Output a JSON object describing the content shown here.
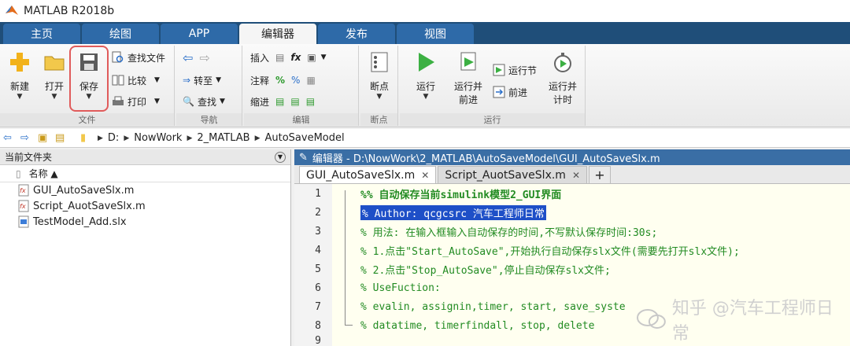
{
  "window": {
    "title": "MATLAB R2018b"
  },
  "tabs": [
    {
      "label": "主页"
    },
    {
      "label": "绘图"
    },
    {
      "label": "APP"
    },
    {
      "label": "编辑器"
    },
    {
      "label": "发布"
    },
    {
      "label": "视图"
    }
  ],
  "ribbon": {
    "file": {
      "label": "文件",
      "new": "新建",
      "open": "打开",
      "save": "保存",
      "find_files": "查找文件",
      "compare": "比较",
      "print": "打印"
    },
    "nav": {
      "label": "导航",
      "goto": "转至",
      "find": "查找"
    },
    "edit": {
      "label": "编辑",
      "insert": "插入",
      "comment": "注释",
      "indent": "缩进"
    },
    "breakpoints": {
      "label": "断点",
      "btn": "断点"
    },
    "run": {
      "label": "运行",
      "run": "运行",
      "run_advance_1": "运行并",
      "run_advance_2": "前进",
      "run_section": "运行节",
      "advance": "前进",
      "run_time_1": "运行并",
      "run_time_2": "计时"
    }
  },
  "address": {
    "crumbs": [
      "D:",
      "NowWork",
      "2_MATLAB",
      "AutoSaveModel"
    ]
  },
  "left_panel": {
    "title": "当前文件夹",
    "column_name": "名称 ▲",
    "files": [
      {
        "name": "GUI_AutoSaveSlx.m",
        "type": "m"
      },
      {
        "name": "Script_AuotSaveSlx.m",
        "type": "m"
      },
      {
        "name": "TestModel_Add.slx",
        "type": "slx"
      }
    ]
  },
  "editor": {
    "title": "编辑器 - D:\\NowWork\\2_MATLAB\\AutoSaveModel\\GUI_AutoSaveSlx.m",
    "tabs": [
      {
        "label": "GUI_AutoSaveSlx.m",
        "active": true
      },
      {
        "label": "Script_AuotSaveSlx.m",
        "active": false
      }
    ],
    "lines": [
      {
        "num": "1",
        "text": "%% 自动保存当前simulink模型2_GUI界面"
      },
      {
        "num": "2",
        "text": "% Author: qcgcsrc 汽车工程师日常"
      },
      {
        "num": "3",
        "text": "% 用法: 在输入框输入自动保存的时间,不写默认保存时间:30s;"
      },
      {
        "num": "4",
        "text": "% 1.点击\"Start_AutoSave\",开始执行自动保存slx文件(需要先打开slx文件);"
      },
      {
        "num": "5",
        "text": "% 2.点击\"Stop_AutoSave\",停止自动保存slx文件;"
      },
      {
        "num": "6",
        "text": "% UseFuction:"
      },
      {
        "num": "7",
        "text": "% evalin, assignin,timer, start, save_syste"
      },
      {
        "num": "8",
        "text": "% datatime, timerfindall, stop, delete"
      },
      {
        "num": "9",
        "text": ""
      }
    ]
  },
  "watermark": {
    "text": "知乎 @汽车工程师日常"
  },
  "colors": {
    "accent": "#1f4e79",
    "comment_green": "#228b22",
    "selection": "#1e4fc7",
    "highlight": "#e05b5b"
  }
}
